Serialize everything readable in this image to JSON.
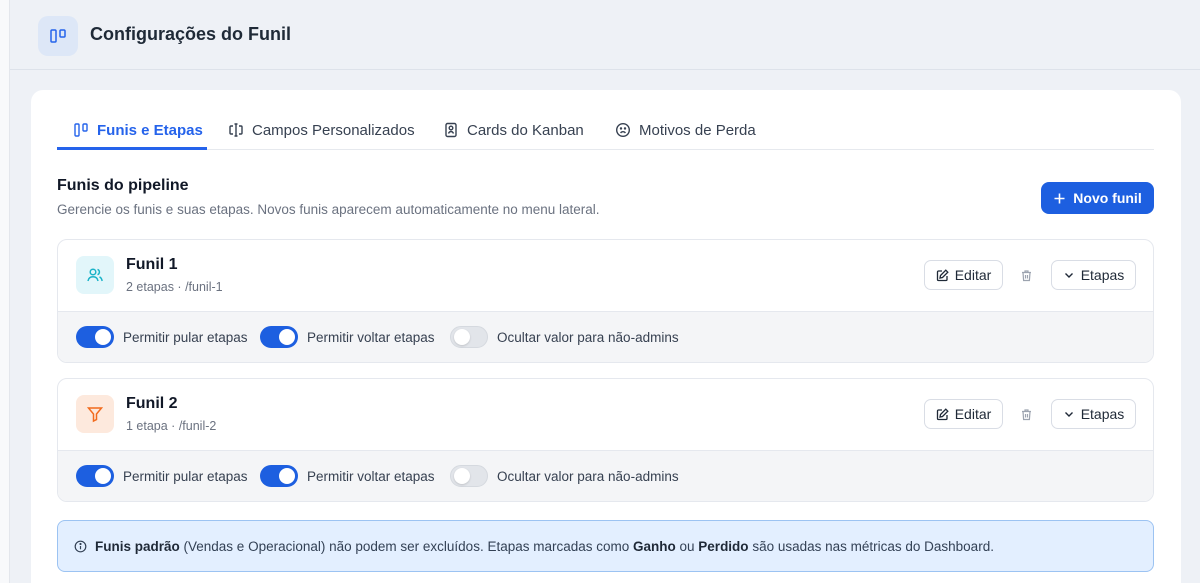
{
  "header": {
    "title": "Configurações do Funil",
    "icon": "kanban-icon"
  },
  "tabs": [
    {
      "label": "Funis e Etapas",
      "icon": "kanban-icon",
      "active": true
    },
    {
      "label": "Campos Personalizados",
      "icon": "text-cursor-input-icon",
      "active": false
    },
    {
      "label": "Cards do Kanban",
      "icon": "id-card-icon",
      "active": false
    },
    {
      "label": "Motivos de Perda",
      "icon": "frown-icon",
      "active": false
    }
  ],
  "section": {
    "title": "Funis do pipeline",
    "subtitle": "Gerencie os funis e suas etapas. Novos funis aparecem automaticamente no menu lateral.",
    "new_button": "Novo funil"
  },
  "funnels": [
    {
      "name": "Funil 1",
      "meta": "2 etapas · /funil-1",
      "icon": "users-icon",
      "icon_color": "#1bb3c8",
      "icon_bg": "#e2f6fa",
      "edit_label": "Editar",
      "stages_label": "Etapas",
      "options": [
        {
          "label": "Permitir pular etapas",
          "enabled": true
        },
        {
          "label": "Permitir voltar etapas",
          "enabled": true
        },
        {
          "label": "Ocultar valor para não-admins",
          "enabled": false
        }
      ]
    },
    {
      "name": "Funil 2",
      "meta": "1 etapa · /funil-2",
      "icon": "filter-icon",
      "icon_color": "#f26b1d",
      "icon_bg": "#fde9dd",
      "edit_label": "Editar",
      "stages_label": "Etapas",
      "options": [
        {
          "label": "Permitir pular etapas",
          "enabled": true
        },
        {
          "label": "Permitir voltar etapas",
          "enabled": true
        },
        {
          "label": "Ocultar valor para não-admins",
          "enabled": false
        }
      ]
    }
  ],
  "notice": {
    "bold1": "Funis padrão",
    "text1": " (Vendas e Operacional) não podem ser excluídos. Etapas marcadas como ",
    "bold2": "Ganho",
    "text2": " ou ",
    "bold3": "Perdido",
    "text3": " são usadas nas métricas do Dashboard."
  },
  "colors": {
    "accent": "#1d5fe0",
    "notice_bg": "#e3efff",
    "notice_border": "#9cc3f2"
  }
}
